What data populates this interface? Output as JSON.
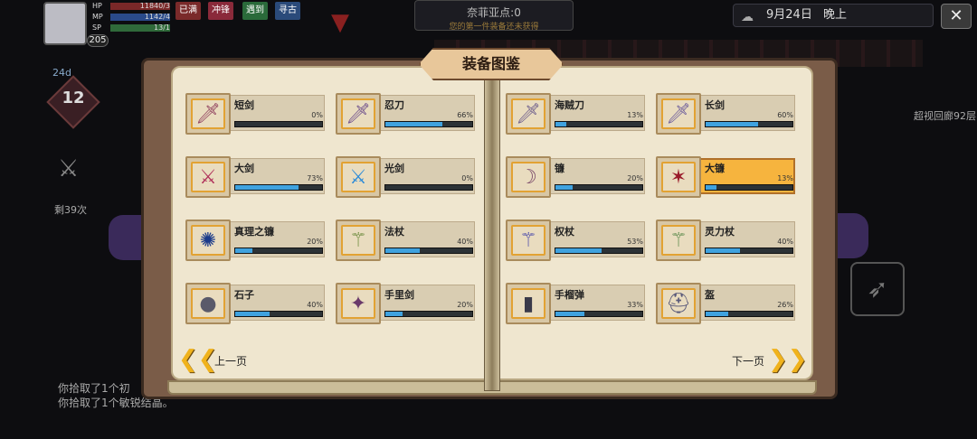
{
  "hud": {
    "level": "205",
    "hp_label": "HP",
    "hp_value": "11840/3",
    "mp_label": "MP",
    "mp_value": "1142/4",
    "sp_label": "SP",
    "sp_value": "13/1",
    "tags": [
      "已满",
      "冲锋",
      "遇到",
      "寻古"
    ],
    "sky_title": "奈菲亚点:0",
    "sky_sub": "您的第一件装备还未获得",
    "date": "9月24日",
    "time_of_day": "晚上",
    "close_label": "✕",
    "left_num": "24d",
    "shield_num": "12",
    "left_count": "剩39次",
    "right_text": "超视回廊92层",
    "log": [
      "你拾取了1个初",
      "你拾取了1个敏锐结晶。"
    ]
  },
  "book": {
    "title": "装备图鉴",
    "prev_label": "上一页",
    "next_label": "下一页"
  },
  "left_page": [
    {
      "name": "短剑",
      "pct": "0%",
      "value": 0,
      "icon": "dagger-icon",
      "glyph": "🗡",
      "color": "#8c3a5a"
    },
    {
      "name": "忍刀",
      "pct": "66%",
      "value": 66,
      "icon": "ninja-sword-icon",
      "glyph": "🗡",
      "color": "#6a4a8a"
    },
    {
      "name": "大剑",
      "pct": "73%",
      "value": 73,
      "icon": "greatsword-icon",
      "glyph": "⚔",
      "color": "#b0305a"
    },
    {
      "name": "光剑",
      "pct": "0%",
      "value": 0,
      "icon": "lightsaber-icon",
      "glyph": "⚔",
      "color": "#2a8ad8"
    },
    {
      "name": "真理之镰",
      "pct": "20%",
      "value": 20,
      "icon": "truth-scythe-icon",
      "glyph": "✺",
      "color": "#1a3a8a"
    },
    {
      "name": "法杖",
      "pct": "40%",
      "value": 40,
      "icon": "staff-icon",
      "glyph": "⚚",
      "color": "#6a8a3a"
    },
    {
      "name": "石子",
      "pct": "40%",
      "value": 40,
      "icon": "stone-icon",
      "glyph": "●",
      "color": "#5a5a6a"
    },
    {
      "name": "手里剑",
      "pct": "20%",
      "value": 20,
      "icon": "shuriken-icon",
      "glyph": "✦",
      "color": "#6a3a6a"
    }
  ],
  "right_page": [
    {
      "name": "海贼刀",
      "pct": "13%",
      "value": 13,
      "icon": "pirate-sword-icon",
      "glyph": "🗡",
      "color": "#6a5a8a",
      "selected": false
    },
    {
      "name": "长剑",
      "pct": "60%",
      "value": 60,
      "icon": "longsword-icon",
      "glyph": "🗡",
      "color": "#6a5a9a",
      "selected": false
    },
    {
      "name": "镰",
      "pct": "20%",
      "value": 20,
      "icon": "sickle-icon",
      "glyph": "☽",
      "color": "#7a4a6a",
      "selected": false
    },
    {
      "name": "大镰",
      "pct": "13%",
      "value": 13,
      "icon": "great-scythe-icon",
      "glyph": "✶",
      "color": "#9a1a2a",
      "selected": true
    },
    {
      "name": "权杖",
      "pct": "53%",
      "value": 53,
      "icon": "scepter-icon",
      "glyph": "⚚",
      "color": "#4a4aaa",
      "selected": false
    },
    {
      "name": "灵力杖",
      "pct": "40%",
      "value": 40,
      "icon": "spirit-staff-icon",
      "glyph": "⚚",
      "color": "#5a8a4a",
      "selected": false
    },
    {
      "name": "手榴弹",
      "pct": "33%",
      "value": 33,
      "icon": "grenade-icon",
      "glyph": "▮",
      "color": "#3a3a4a",
      "selected": false
    },
    {
      "name": "盔",
      "pct": "26%",
      "value": 26,
      "icon": "helmet-icon",
      "glyph": "⛑",
      "color": "#5a5a7a",
      "selected": false
    }
  ]
}
